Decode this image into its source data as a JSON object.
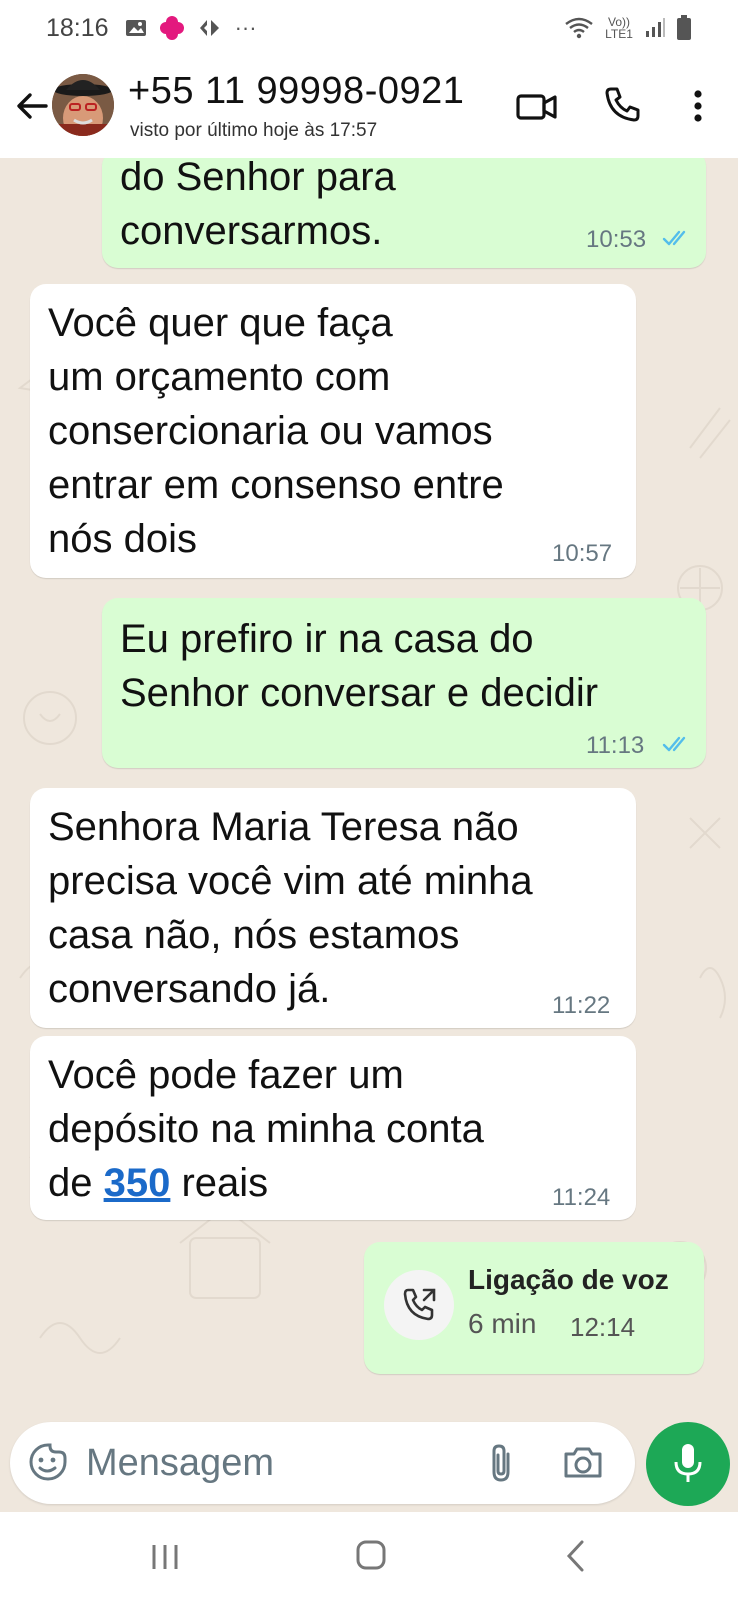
{
  "status_bar": {
    "time": "18:16",
    "network": "Vo)) LTE1"
  },
  "header": {
    "contact_name": "+55 11 99998-0921",
    "last_seen": "visto por último hoje às 17:57"
  },
  "messages": [
    {
      "direction": "out",
      "text": "do Senhor para\nconversarmos.",
      "time": "10:53",
      "status": "read"
    },
    {
      "direction": "in",
      "text": "Você quer que faça\num orçamento com\nconsercionaria ou vamos\nentrar em consenso entre\nnós dois",
      "time": "10:57"
    },
    {
      "direction": "out",
      "text": "Eu prefiro ir na casa do\nSenhor conversar e decidir",
      "time": "11:13",
      "status": "read"
    },
    {
      "direction": "in",
      "text": "Senhora Maria Teresa não\nprecisa você vim até minha\ncasa não, nós estamos\nconversando já.",
      "time": "11:22"
    },
    {
      "direction": "in",
      "text_before": "Você pode fazer um\ndepósito na minha conta\nde ",
      "amount": "350",
      "text_after": " reais",
      "time": "11:24"
    }
  ],
  "voice_call": {
    "title": "Ligação de voz",
    "duration": "6 min",
    "time": "12:14"
  },
  "composer": {
    "placeholder": "Mensagem"
  },
  "colors": {
    "outgoing_bubble": "#d9fdd3",
    "incoming_bubble": "#ffffff",
    "chat_background": "#efe7dd",
    "read_ticks": "#53bdeb",
    "mic_button": "#1da856",
    "link": "#1b6ac9"
  },
  "icons": {
    "back": "arrow-left-icon",
    "video": "video-camera-icon",
    "call": "phone-icon",
    "menu": "kebab-menu-icon",
    "emoji": "sticker-emoji-icon",
    "attach": "paperclip-icon",
    "camera": "camera-icon",
    "mic": "microphone-icon",
    "voice_call": "incoming-call-icon"
  }
}
